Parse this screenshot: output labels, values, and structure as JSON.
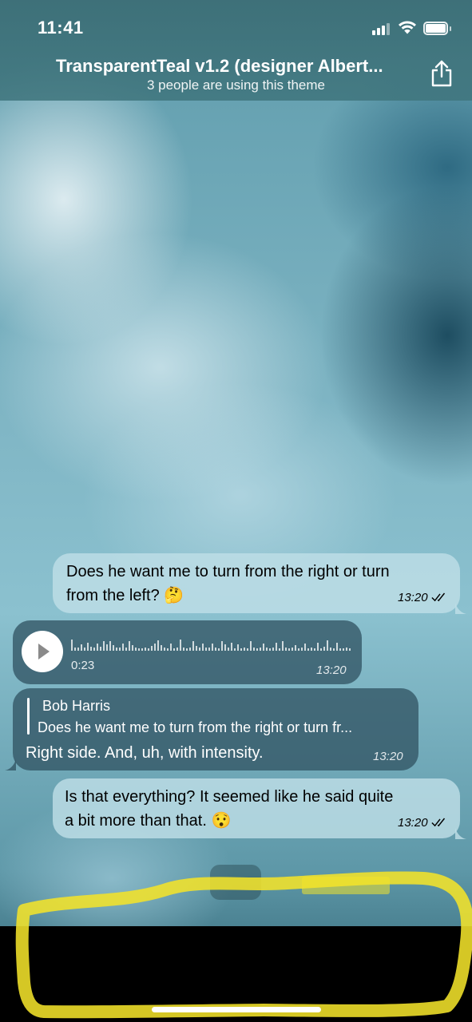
{
  "status_bar": {
    "time": "11:41"
  },
  "header": {
    "title": "TransparentTeal v1.2 (designer Albert...",
    "subtitle": "3 people are using this theme"
  },
  "messages": [
    {
      "kind": "outgoing_text",
      "text_line1": "Does he want me to turn from the right or turn",
      "text_line2": "from the left? 🤔",
      "time": "13:20",
      "read_icon": "double-check-icon"
    },
    {
      "kind": "incoming_voice",
      "duration": "0:23",
      "time": "13:20",
      "play_icon": "play-icon"
    },
    {
      "kind": "incoming_reply",
      "reply_author": "Bob Harris",
      "reply_text": "Does he want me to turn from the right or turn fr...",
      "text": "Right side. And, uh, with intensity.",
      "time": "13:20"
    },
    {
      "kind": "outgoing_text",
      "text_line1": "Is that everything? It seemed like he said quite",
      "text_line2": "a bit more than that. 😯",
      "time": "13:20",
      "read_icon": "double-check-icon"
    }
  ],
  "colors": {
    "outgoing_bubble": "#bedee6",
    "incoming_bubble": "#325564",
    "highlight_marker": "#f2e32a"
  }
}
